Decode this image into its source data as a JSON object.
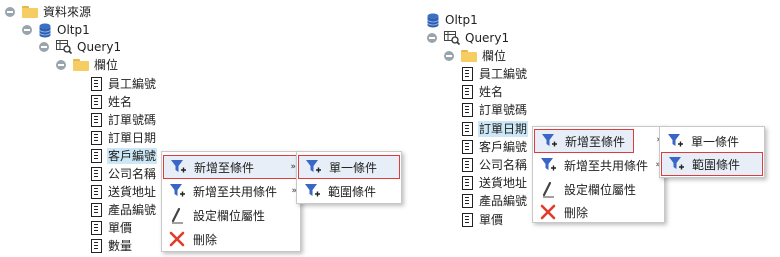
{
  "left_tree": {
    "root_folder": "資料來源",
    "datasource": "Oltp1",
    "query": "Query1",
    "columns_folder": "欄位",
    "columns": [
      "員工編號",
      "姓名",
      "訂單號碼",
      "訂單日期",
      "客戶編號",
      "公司名稱",
      "送貨地址",
      "產品編號",
      "單價",
      "數量"
    ],
    "selected_column": "客戶編號"
  },
  "left_menu": {
    "items": [
      {
        "label": "新增至條件",
        "icon": "filter-add-icon",
        "submenu_arrow": "»"
      },
      {
        "label": "新增至共用條件",
        "icon": "filter-add-icon",
        "submenu_arrow": "»"
      },
      {
        "label": "設定欄位屬性",
        "icon": "pencil-icon"
      },
      {
        "label": "刪除",
        "icon": "delete-x-icon"
      }
    ],
    "submenu": [
      {
        "label": "單一條件",
        "icon": "filter-add-icon"
      },
      {
        "label": "範圍條件",
        "icon": "filter-add-icon"
      }
    ]
  },
  "right_tree": {
    "datasource": "Oltp1",
    "query": "Query1",
    "columns_folder": "欄位",
    "columns": [
      "員工編號",
      "姓名",
      "訂單號碼",
      "訂單日期",
      "客戶編號",
      "公司名稱",
      "送貨地址",
      "產品編號",
      "單價"
    ],
    "selected_column": "訂單日期"
  },
  "right_menu": {
    "items": [
      {
        "label": "新增至條件",
        "icon": "filter-add-icon",
        "submenu_arrow": "»"
      },
      {
        "label": "新增至共用條件",
        "icon": "filter-add-icon",
        "submenu_arrow": "»"
      },
      {
        "label": "設定欄位屬性",
        "icon": "pencil-icon"
      },
      {
        "label": "刪除",
        "icon": "delete-x-icon"
      }
    ],
    "submenu": [
      {
        "label": "單一條件",
        "icon": "filter-add-icon"
      },
      {
        "label": "範圍條件",
        "icon": "filter-add-icon"
      }
    ]
  },
  "colors": {
    "selection": "#cce8f6",
    "highlight_border": "#dd3c3c",
    "folder": "#f5cd62",
    "database": "#3b6fc4",
    "filter_icon": "#3a66c6",
    "delete_icon": "#e03c2c"
  }
}
